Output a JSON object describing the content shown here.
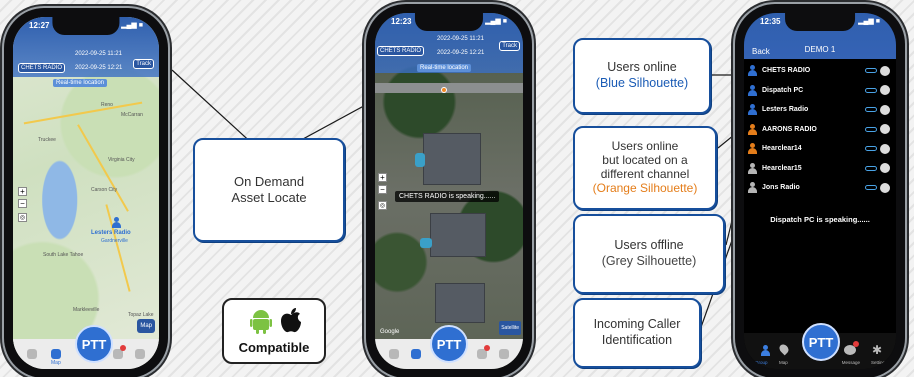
{
  "colors": {
    "accent": "#174f9c",
    "online": "#2f6fd1",
    "other_channel": "#e47d1a",
    "offline": "#b5b5b5"
  },
  "phone1": {
    "time": "12:27",
    "channel": "CHETS RADIO",
    "date1": "2022-09-25 11:21",
    "date2": "2022-09-25 12:21",
    "track_label": "Track",
    "banner": "Real-time location",
    "map_labels": [
      "Reno",
      "McCarran",
      "Truckee",
      "Virginia City",
      "Carson City",
      "South Lake Tahoe",
      "Markleeville",
      "Topaz Lake"
    ],
    "marker_label": "Lesters Radio",
    "marker_sub": "Gardnerville",
    "ptt_label": "PTT",
    "map_button": "Map",
    "nav_map": "Map"
  },
  "phone2": {
    "time": "12:23",
    "channel": "CHETS RADIO",
    "date1": "2022-09-25 11:21",
    "date2": "2022-09-25 12:21",
    "track_label": "Track",
    "banner": "Real-time location",
    "speaking": "CHETS RADIO is speaking......",
    "ptt_label": "PTT",
    "google": "Google",
    "satellite": "Satellite"
  },
  "phone3": {
    "time": "12:35",
    "back": "Back",
    "title": "DEMO 1",
    "users": [
      {
        "name": "CHETS RADIO",
        "status": "online"
      },
      {
        "name": "Dispatch PC",
        "status": "online"
      },
      {
        "name": "Lesters Radio",
        "status": "online"
      },
      {
        "name": "AARONS RADIO",
        "status": "other"
      },
      {
        "name": "Hearclear14",
        "status": "other"
      },
      {
        "name": "Hearclear15",
        "status": "offline"
      },
      {
        "name": "Jons Radio",
        "status": "offline"
      }
    ],
    "speaking": "Dispatch PC is speaking......",
    "ptt_label": "PTT",
    "nav": [
      "Group",
      "Map",
      "Message",
      "Setting"
    ]
  },
  "callouts": {
    "asset_locate": [
      "On Demand",
      "Asset Locate"
    ],
    "online_main": "Users online",
    "online_sub": "(Blue Silhouette)",
    "other_main": [
      "Users online",
      "but located on a",
      "different channel"
    ],
    "other_sub": "(Orange Silhouette)",
    "offline_main": "Users offline",
    "offline_sub": "(Grey Silhouette)",
    "caller": [
      "Incoming Caller",
      "Identification"
    ]
  },
  "compatible": {
    "label": "Compatible",
    "icons": [
      "android-icon",
      "apple-icon"
    ]
  }
}
